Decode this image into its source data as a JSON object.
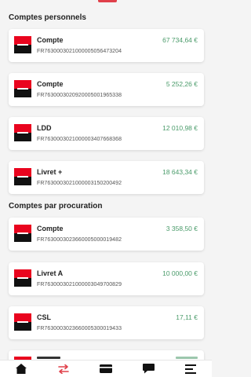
{
  "sections": [
    {
      "title": "Comptes personnels",
      "accounts": [
        {
          "name": "Compte",
          "iban": "FR7630003021000005056473204",
          "amount": "67 734,64 €"
        },
        {
          "name": "Compte",
          "iban": "FR7630003020920005001965338",
          "amount": "5 252,26 €"
        },
        {
          "name": "LDD",
          "iban": "FR7630003021000003407668368",
          "amount": "12 010,98 €"
        },
        {
          "name": "Livret +",
          "iban": "FR7630003021000003150200492",
          "amount": "18 643,34 €"
        }
      ]
    },
    {
      "title": "Comptes par procuration",
      "accounts": [
        {
          "name": "Compte",
          "iban": "FR7630003023660005000019482",
          "amount": "3 358,50 €"
        },
        {
          "name": "Livret A",
          "iban": "FR7630003021000003049700829",
          "amount": "10 000,00 €"
        },
        {
          "name": "CSL",
          "iban": "FR7630003023660005300019433",
          "amount": "17,11 €"
        }
      ]
    }
  ],
  "colors": {
    "brand_red": "#e9041e",
    "brand_black": "#111111",
    "amount_green": "#4a9b6a",
    "accent": "#e0404a"
  },
  "nav": {
    "items": [
      "home-icon",
      "transfer-icon",
      "card-icon",
      "messages-icon",
      "menu-icon"
    ]
  }
}
